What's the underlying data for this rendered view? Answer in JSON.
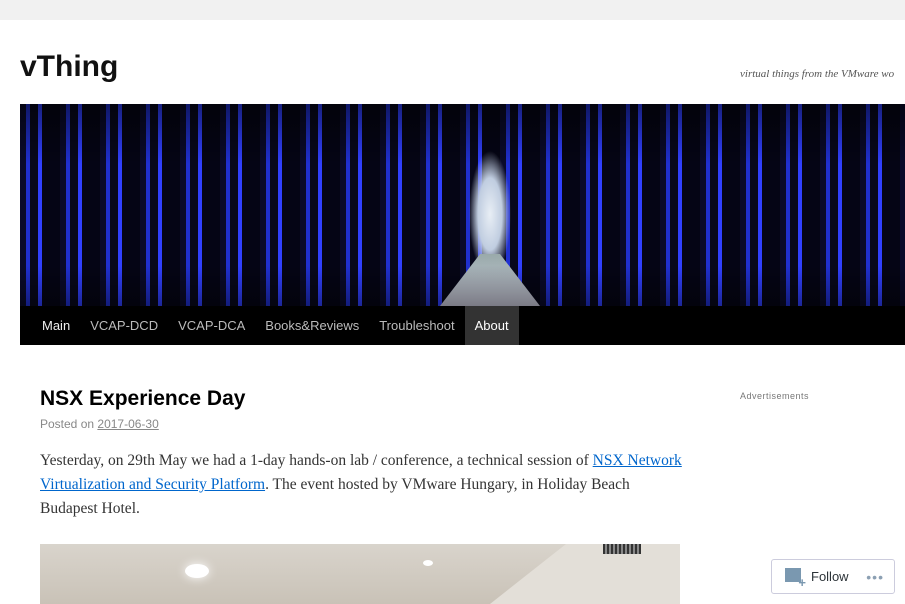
{
  "site": {
    "title": "vThing",
    "tagline": "virtual things from the VMware wo"
  },
  "nav": {
    "items": [
      {
        "label": "Main"
      },
      {
        "label": "VCAP-DCD"
      },
      {
        "label": "VCAP-DCA"
      },
      {
        "label": "Books&Reviews"
      },
      {
        "label": "Troubleshoot"
      },
      {
        "label": "About"
      }
    ]
  },
  "post": {
    "title": "NSX Experience Day",
    "posted_on": "Posted on",
    "date": "2017-06-30",
    "text_1": "Yesterday, on 29th May we had a 1-day hands-on lab / conference, a technical session of ",
    "link": "NSX Network Virtualization and Security Platform",
    "text_2": ". The event hosted by VMware Hungary, in Holiday Beach Budapest Hotel."
  },
  "sidebar": {
    "ads_label": "Advertisements"
  },
  "follow": {
    "label": "Follow",
    "more": "•••"
  },
  "colors": {
    "link": "#0066cc",
    "nav_bg": "#000000",
    "nav_active": "#333333"
  }
}
